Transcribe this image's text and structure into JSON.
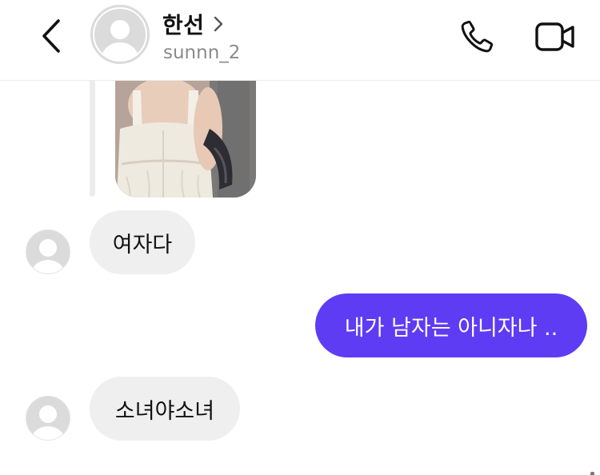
{
  "header": {
    "contact_name": "한선",
    "contact_handle": "sunnn_2"
  },
  "messages": [
    {
      "direction": "incoming",
      "text": "여자다"
    },
    {
      "direction": "outgoing",
      "text": "내가 남자는 아니자나 .."
    },
    {
      "direction": "incoming",
      "text": "소녀야소녀"
    }
  ],
  "colors": {
    "outgoing_bubble": "#5d3cf4",
    "incoming_bubble": "#efeff0",
    "secondary_text": "#8a8a8a"
  },
  "icons": {
    "back": "chevron-left-icon",
    "profile_chevron": "chevron-right-icon",
    "call": "phone-icon",
    "video": "video-camera-icon"
  }
}
